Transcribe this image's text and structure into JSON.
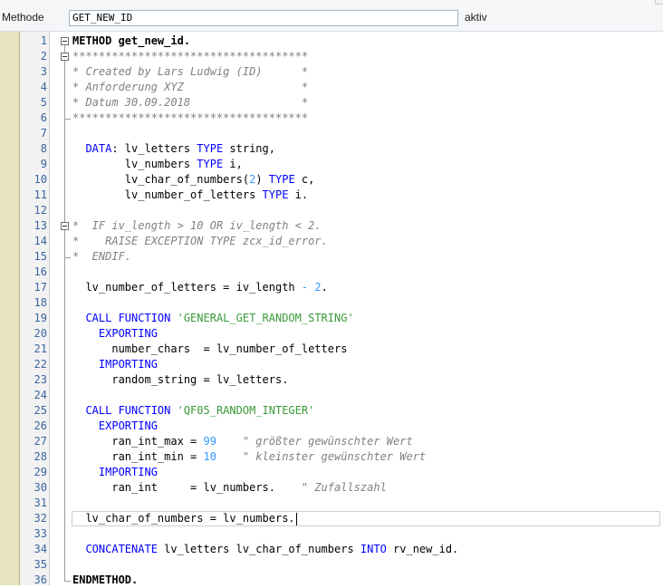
{
  "header": {
    "method_label": "Methode",
    "method_name": "GET_NEW_ID",
    "status": "aktiv"
  },
  "editor": {
    "lines": [
      {
        "n": "1",
        "text": "METHOD get_new_id.",
        "style": "method"
      },
      {
        "n": "2",
        "text": "************************************",
        "style": "cmt"
      },
      {
        "n": "3",
        "text": "* Created by Lars Ludwig (ID)      *",
        "style": "cmt"
      },
      {
        "n": "4",
        "text": "* Anforderung XYZ                  *",
        "style": "cmt"
      },
      {
        "n": "5",
        "text": "* Datum 30.09.2018                 *",
        "style": "cmt"
      },
      {
        "n": "6",
        "text": "************************************",
        "style": "cmt"
      },
      {
        "n": "7",
        "text": ""
      },
      {
        "n": "8",
        "text": "  DATA: lv_letters TYPE string,"
      },
      {
        "n": "9",
        "text": "        lv_numbers TYPE i,"
      },
      {
        "n": "10",
        "text": "        lv_char_of_numbers(2) TYPE c,"
      },
      {
        "n": "11",
        "text": "        lv_number_of_letters TYPE i."
      },
      {
        "n": "12",
        "text": ""
      },
      {
        "n": "13",
        "text": "*  IF iv_length > 10 OR iv_length < 2.",
        "style": "cmt"
      },
      {
        "n": "14",
        "text": "*    RAISE EXCEPTION TYPE zcx_id_error.",
        "style": "cmt"
      },
      {
        "n": "15",
        "text": "*  ENDIF.",
        "style": "cmt"
      },
      {
        "n": "16",
        "text": ""
      },
      {
        "n": "17",
        "text": "  lv_number_of_letters = iv_length - 2."
      },
      {
        "n": "18",
        "text": ""
      },
      {
        "n": "19",
        "text": "  CALL FUNCTION 'GENERAL_GET_RANDOM_STRING'"
      },
      {
        "n": "20",
        "text": "    EXPORTING"
      },
      {
        "n": "21",
        "text": "      number_chars  = lv_number_of_letters"
      },
      {
        "n": "22",
        "text": "    IMPORTING"
      },
      {
        "n": "23",
        "text": "      random_string = lv_letters."
      },
      {
        "n": "24",
        "text": ""
      },
      {
        "n": "25",
        "text": "  CALL FUNCTION 'QF05_RANDOM_INTEGER'"
      },
      {
        "n": "26",
        "text": "    EXPORTING"
      },
      {
        "n": "27",
        "text": "      ran_int_max = 99    \" größter gewünschter Wert"
      },
      {
        "n": "28",
        "text": "      ran_int_min = 10    \" kleinster gewünschter Wert"
      },
      {
        "n": "29",
        "text": "    IMPORTING"
      },
      {
        "n": "30",
        "text": "      ran_int     = lv_numbers.    \" Zufallszahl"
      },
      {
        "n": "31",
        "text": ""
      },
      {
        "n": "32",
        "text": "  lv_char_of_numbers = lv_numbers.",
        "current": true
      },
      {
        "n": "33",
        "text": ""
      },
      {
        "n": "34",
        "text": "  CONCATENATE lv_letters lv_char_of_numbers INTO rv_new_id."
      },
      {
        "n": "35",
        "text": ""
      },
      {
        "n": "36",
        "text": "ENDMETHOD.",
        "style": "method"
      }
    ]
  }
}
